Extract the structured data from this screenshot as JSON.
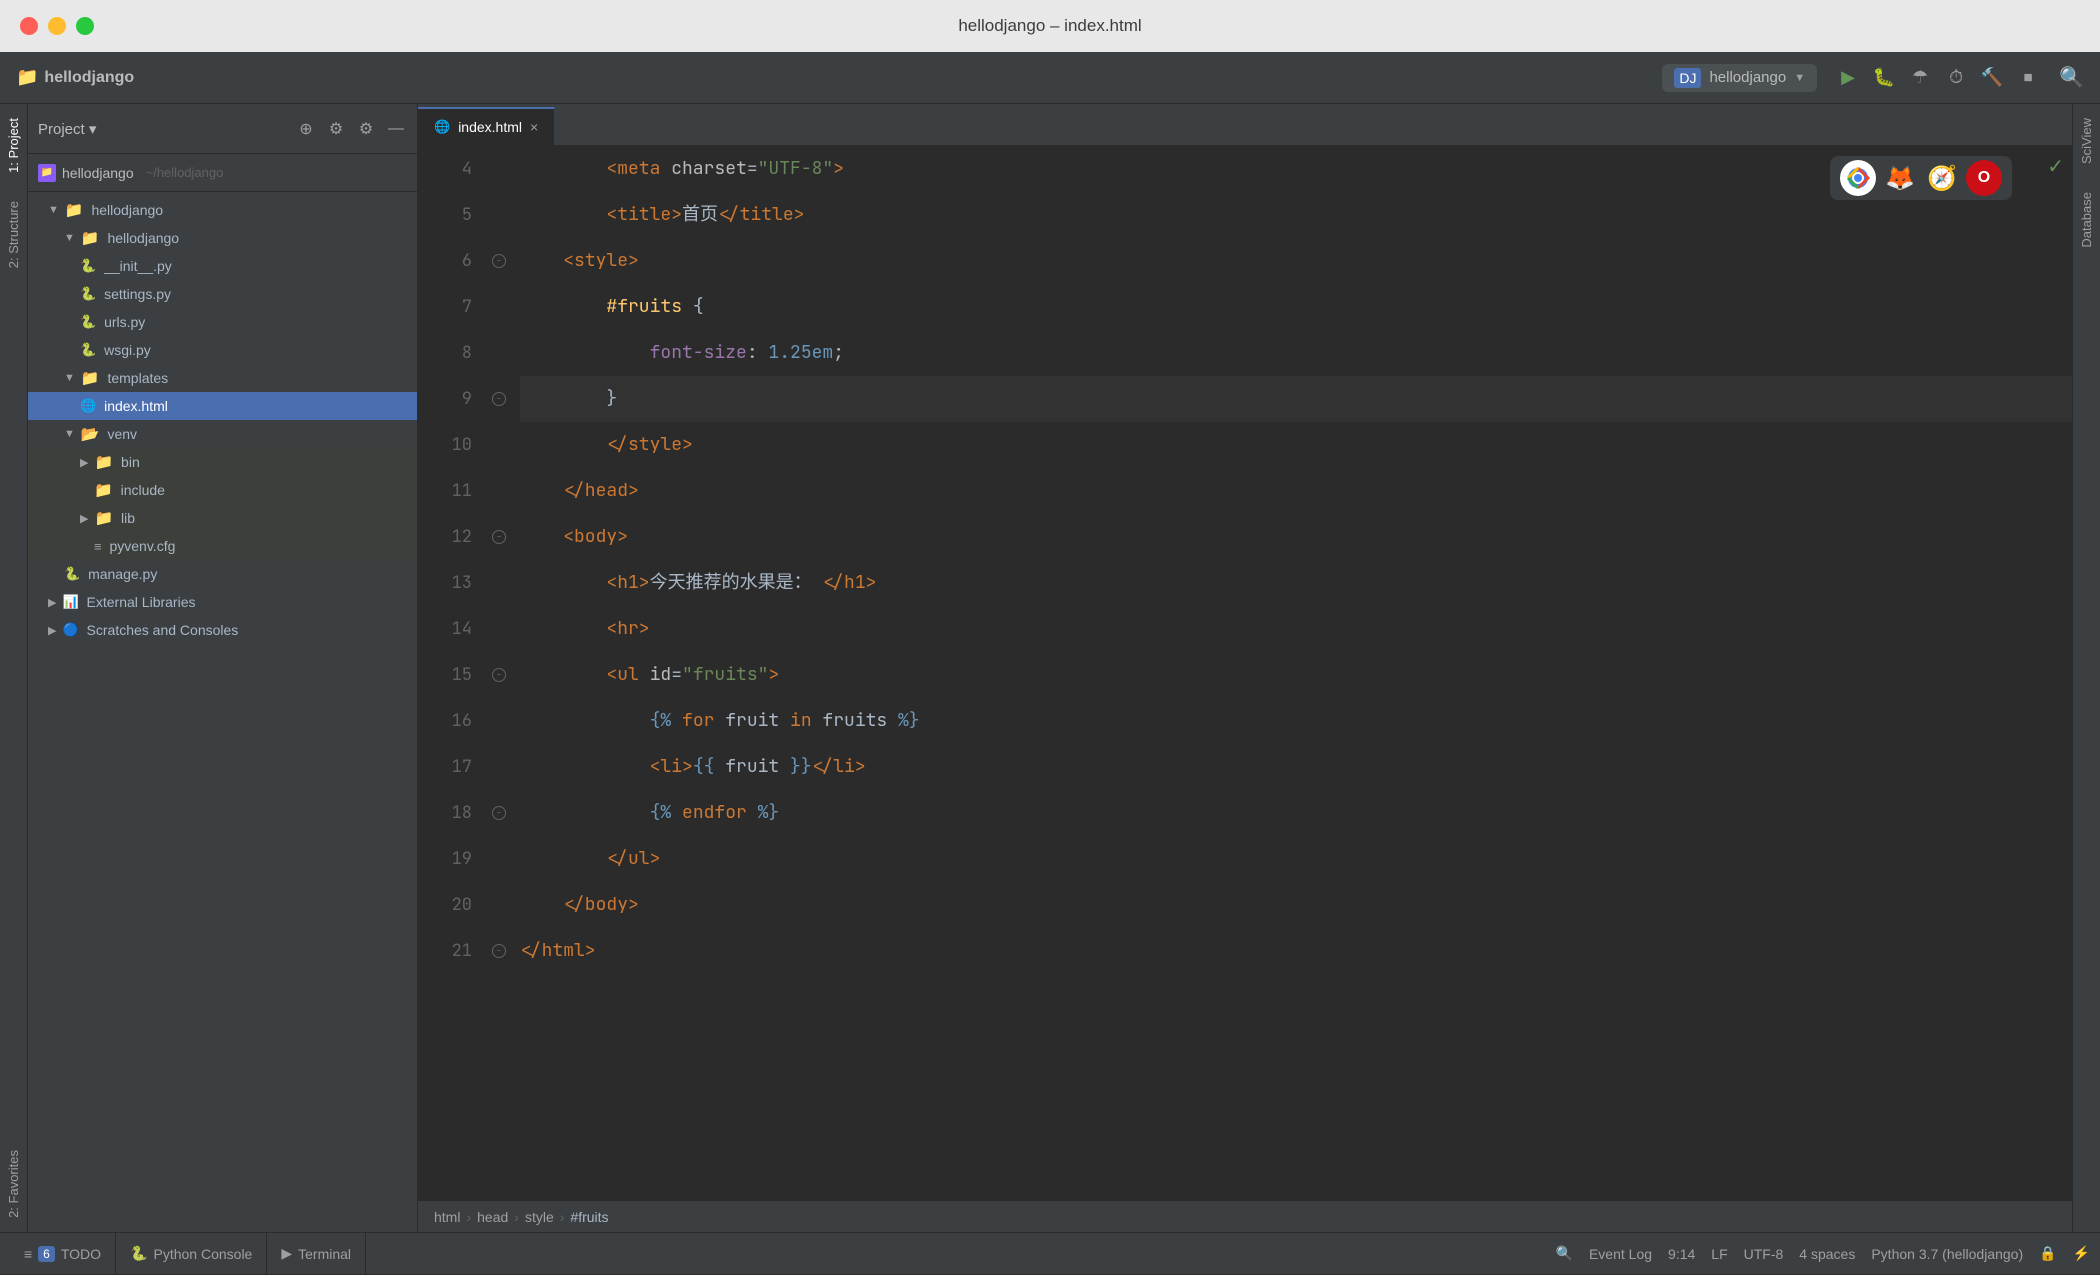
{
  "titlebar": {
    "title": "hellodjango – index.html"
  },
  "ide_toolbar": {
    "run_config": "hellodjango",
    "django_icon": "🎯"
  },
  "project_panel": {
    "title": "Project",
    "header": {
      "icon_label": "H",
      "name": "hellodjango",
      "path": "~/hellodjango"
    },
    "tree": [
      {
        "id": "hellodjango-root",
        "label": "hellodjango",
        "type": "folder",
        "indent": 1,
        "expanded": true,
        "icon_class": "icon-folder"
      },
      {
        "id": "hellodjango-inner",
        "label": "hellodjango",
        "type": "folder",
        "indent": 2,
        "expanded": true,
        "icon_class": "icon-folder"
      },
      {
        "id": "init-py",
        "label": "__init__.py",
        "type": "py",
        "indent": 3
      },
      {
        "id": "settings-py",
        "label": "settings.py",
        "type": "py",
        "indent": 3
      },
      {
        "id": "urls-py",
        "label": "urls.py",
        "type": "py",
        "indent": 3
      },
      {
        "id": "wsgi-py",
        "label": "wsgi.py",
        "type": "py",
        "indent": 3
      },
      {
        "id": "templates",
        "label": "templates",
        "type": "folder",
        "indent": 2,
        "expanded": true,
        "icon_class": "icon-folder"
      },
      {
        "id": "index-html",
        "label": "index.html",
        "type": "html",
        "indent": 3,
        "selected": true
      },
      {
        "id": "venv",
        "label": "venv",
        "type": "folder",
        "indent": 2,
        "expanded": true,
        "highlighted": true,
        "icon_class": "icon-folder"
      },
      {
        "id": "bin",
        "label": "bin",
        "type": "folder",
        "indent": 3,
        "highlighted": true,
        "icon_class": "icon-folder"
      },
      {
        "id": "include",
        "label": "include",
        "type": "folder",
        "indent": 3,
        "highlighted": true,
        "icon_class": "icon-folder"
      },
      {
        "id": "lib",
        "label": "lib",
        "type": "folder",
        "indent": 3,
        "collapsed": true,
        "highlighted": true,
        "icon_class": "icon-folder"
      },
      {
        "id": "pyvenv-cfg",
        "label": "pyvenv.cfg",
        "type": "cfg",
        "indent": 3,
        "highlighted": true
      },
      {
        "id": "manage-py",
        "label": "manage.py",
        "type": "py",
        "indent": 2
      },
      {
        "id": "external-libs",
        "label": "External Libraries",
        "type": "special",
        "indent": 1,
        "collapsed": true
      },
      {
        "id": "scratches",
        "label": "Scratches and Consoles",
        "type": "special",
        "indent": 1,
        "collapsed": true
      }
    ]
  },
  "tabs": [
    {
      "id": "index-html-tab",
      "label": "index.html",
      "active": true,
      "icon": "html"
    }
  ],
  "code_lines": [
    {
      "num": 4,
      "content": "        <meta charset=\"UTF-8\">",
      "type": "html"
    },
    {
      "num": 5,
      "content": "        <title>首页</title>",
      "type": "html"
    },
    {
      "num": 6,
      "content": "    <style>",
      "type": "html",
      "fold": true
    },
    {
      "num": 7,
      "content": "        #fruits {",
      "type": "css"
    },
    {
      "num": 8,
      "content": "            font-size: 1.25em;",
      "type": "css"
    },
    {
      "num": 9,
      "content": "        }",
      "type": "css",
      "highlighted": true,
      "fold": true
    },
    {
      "num": 10,
      "content": "        </style>",
      "type": "html"
    },
    {
      "num": 11,
      "content": "    </head>",
      "type": "html"
    },
    {
      "num": 12,
      "content": "    <body>",
      "type": "html",
      "fold": true
    },
    {
      "num": 13,
      "content": "        <h1>今天推荐的水果是：</h1>",
      "type": "html"
    },
    {
      "num": 14,
      "content": "        <hr>",
      "type": "html"
    },
    {
      "num": 15,
      "content": "        <ul id=\"fruits\">",
      "type": "html",
      "fold": true
    },
    {
      "num": 16,
      "content": "            {% for fruit in fruits %}",
      "type": "template"
    },
    {
      "num": 17,
      "content": "            <li>{{ fruit }}</li>",
      "type": "template"
    },
    {
      "num": 18,
      "content": "            {% endfor %}",
      "type": "template",
      "fold": true
    },
    {
      "num": 19,
      "content": "        </ul>",
      "type": "html"
    },
    {
      "num": 20,
      "content": "    </body>",
      "type": "html"
    },
    {
      "num": 21,
      "content": "</html>",
      "type": "html",
      "fold": true
    }
  ],
  "breadcrumb": {
    "items": [
      "html",
      "head",
      "style",
      "#fruits"
    ]
  },
  "bottom_tabs": [
    {
      "label": "6: TODO",
      "icon": "≡",
      "num": "6"
    },
    {
      "label": "Python Console",
      "icon": "🐍"
    },
    {
      "label": "Terminal",
      "icon": "▶"
    }
  ],
  "status_bar": {
    "cursor": "9:14",
    "line_ending": "LF",
    "encoding": "UTF-8",
    "indent": "4 spaces",
    "interpreter": "Python 3.7 (hellodjango)"
  },
  "browser_icons": [
    {
      "name": "Chrome",
      "color": "#4285f4"
    },
    {
      "name": "Firefox",
      "color": "#ff6611"
    },
    {
      "name": "Safari",
      "color": "#1a73e8"
    },
    {
      "name": "Opera",
      "color": "#cc0f16"
    }
  ],
  "right_sidebar": {
    "tabs": [
      "SciView",
      "Database"
    ]
  }
}
